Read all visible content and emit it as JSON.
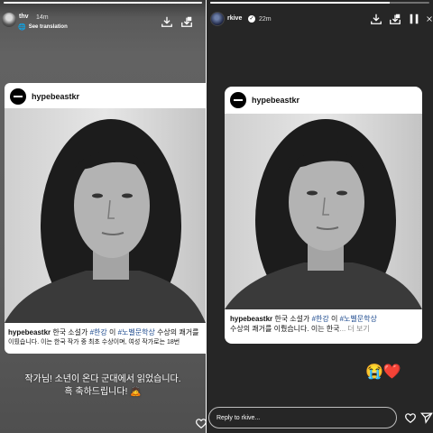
{
  "left_story": {
    "progress_fraction": 1.0,
    "username": "thv",
    "time": "14m",
    "see_translation": "See translation",
    "post": {
      "account": "hypebeastkr",
      "caption_user": "hypebeastkr",
      "caption_text_1": " 한국 소설가 ",
      "caption_tag_1": "#한강",
      "caption_text_2": " 이 ",
      "caption_tag_2": "#노벨문학상",
      "caption_text_3": " 수상의 쾌거를",
      "caption_line2": "이뤘습니다. 이는 한국 작가 중 최초 수상이며, 여성 작가로는 18번"
    },
    "story_text_line1": "작가님! 소년이 온다 군대에서 읽었습니다.",
    "story_text_line2": "흑 축하드립니다! 🙇"
  },
  "right_story": {
    "progress_fraction": 0.82,
    "username": "rkive",
    "time": "22m",
    "post": {
      "account": "hypebeastkr",
      "caption_user": "hypebeastkr",
      "caption_text_1": " 한국 소설가 ",
      "caption_tag_1": "#한강",
      "caption_text_2": " 이 ",
      "caption_tag_2": "#노벨문학상",
      "caption_line2_text": "수상의 쾌거를 이뤘습니다. 이는 한국",
      "caption_more": "... 더 보기"
    },
    "emojis": "😭❤️",
    "reply_placeholder": "Reply to rkive..."
  },
  "icons": {
    "download": "download-icon",
    "share": "share-icon",
    "pause": "pause-icon",
    "heart": "heart-icon",
    "send": "send-icon",
    "globe": "globe-icon",
    "verified": "verified-badge-icon"
  },
  "colors": {
    "hashtag": "#1e4b8f",
    "right_background": "#262626"
  }
}
